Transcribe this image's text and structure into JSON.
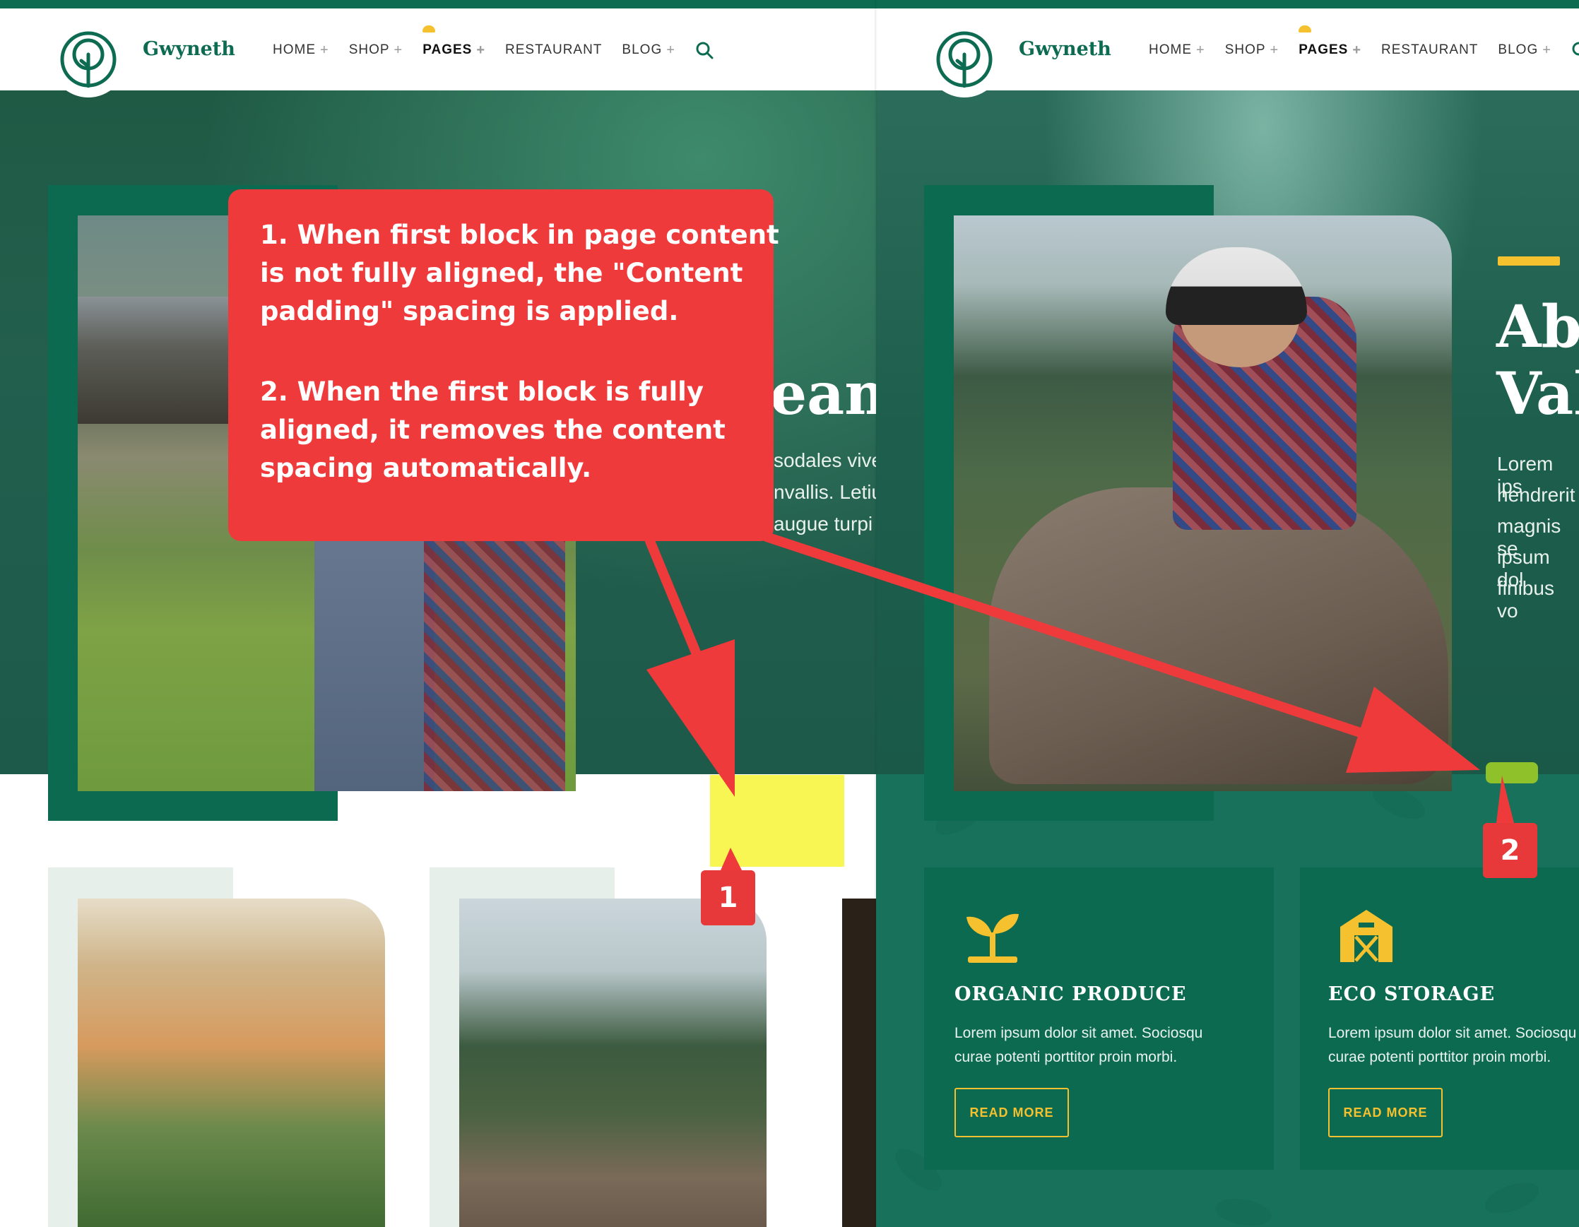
{
  "left": {
    "brand": "Gwyneth",
    "nav": [
      "HOME",
      "SHOP",
      "PAGES",
      "RESTAURANT",
      "BLOG"
    ],
    "hero_word": "eam",
    "hero_lines": [
      "sodales vive",
      "nvallis. Letiu",
      "augue turpi"
    ]
  },
  "right": {
    "brand": "Gwyneth",
    "nav": [
      "HOME",
      "SHOP",
      "PAGES",
      "RESTAURANT",
      "BLOG"
    ],
    "hero_title_1": "Abo",
    "hero_title_2": "Val",
    "hero_lines": [
      "Lorem ips",
      "hendrerit",
      "magnis se",
      "ipsum dol",
      "finibus vo"
    ],
    "features": [
      {
        "title": "ORGANIC PRODUCE",
        "text_1": "Lorem ipsum dolor sit amet. Sociosqu",
        "text_2": "curae potenti porttitor proin morbi.",
        "button": "READ MORE"
      },
      {
        "title": "ECO STORAGE",
        "text_1": "Lorem ipsum dolor sit amet. Sociosqu",
        "text_2": "curae potenti porttitor proin morbi.",
        "button": "READ MORE"
      }
    ]
  },
  "annotation": {
    "lines": [
      "1. When first block in page content",
      "is not fully aligned, the \"Content",
      "padding\" spacing is applied.",
      "2. When the first block is fully",
      "aligned, it removes the content",
      "spacing automatically."
    ],
    "marker_1": "1",
    "marker_2": "2"
  },
  "colors": {
    "brand_green": "#0d6b52",
    "accent_yellow": "#f5c12e",
    "annotation_red": "#ef3a3b"
  }
}
